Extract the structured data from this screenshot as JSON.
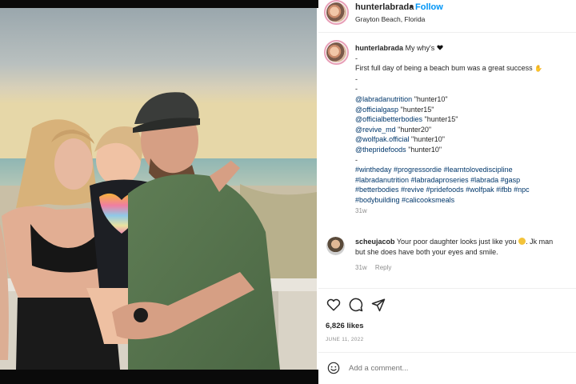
{
  "header": {
    "username": "hunterlabrada",
    "separator": "•",
    "follow_label": "Follow",
    "location": "Grayton Beach, Florida"
  },
  "caption": {
    "username": "hunterlabrada",
    "title": "My why's",
    "lines": [
      "-",
      "First full day of being a beach bum was a great success",
      "-",
      "-"
    ],
    "codes": [
      {
        "handle": "@labradanutrition",
        "code": "\"hunter10\""
      },
      {
        "handle": "@officialgasp",
        "code": "\"hunter15\""
      },
      {
        "handle": "@officialbetterbodies",
        "code": "\"hunter15\""
      },
      {
        "handle": "@revive_md",
        "code": "\"hunter20\""
      },
      {
        "handle": "@wolfpak.official",
        "code": "\"hunter10\""
      },
      {
        "handle": "@thepridefoods",
        "code": "\"hunter10\""
      }
    ],
    "dash_after_codes": "-",
    "hashtag_lines": [
      "#wintheday #progressordie #learntolovediscipline",
      "#labradanutrition #labradaproseries #labrada #gasp",
      "#betterbodies #revive #pridefoods #wolfpak #ifbb #npc",
      "#bodybuilding #calicooksmeals"
    ],
    "age": "31w"
  },
  "comment": {
    "username": "scheujacob",
    "line1": "Your poor daughter looks just like you",
    "line1_suffix": ". Jk man",
    "line2": "but she does have both your eyes and smile.",
    "age": "31w",
    "reply_label": "Reply"
  },
  "actions": {
    "icons": [
      "heart-icon",
      "comment-icon",
      "share-icon"
    ]
  },
  "likes": "6,826 likes",
  "date": "JUNE 11, 2022",
  "add_comment": {
    "placeholder": "Add a comment..."
  },
  "colors": {
    "link": "#00376b",
    "follow": "#0095f6",
    "muted": "#8e8e8e"
  }
}
